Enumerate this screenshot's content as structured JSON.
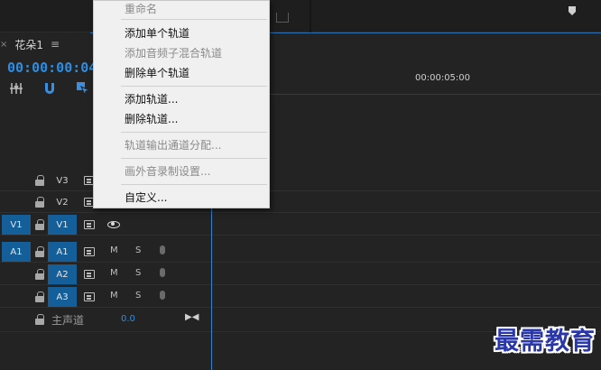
{
  "sequence": {
    "tab_label": "花朵1",
    "close_icon": "×",
    "menu_icon": "≡"
  },
  "timeline": {
    "timecode": "00:00:00:04",
    "ruler_time": "00:00:05:00"
  },
  "context_menu": {
    "items": [
      {
        "label": "重命名",
        "enabled": false
      },
      {
        "label": "添加单个轨道",
        "enabled": true
      },
      {
        "label": "添加音频子混合轨道",
        "enabled": false
      },
      {
        "label": "删除单个轨道",
        "enabled": true
      },
      {
        "label": "添加轨道...",
        "enabled": true
      },
      {
        "label": "删除轨道...",
        "enabled": true
      },
      {
        "label": "轨道输出通道分配...",
        "enabled": false
      },
      {
        "label": "画外音录制设置...",
        "enabled": false
      },
      {
        "label": "自定义...",
        "enabled": true
      }
    ]
  },
  "tracks": {
    "v3": {
      "target": "V3"
    },
    "v2": {
      "target": "V2"
    },
    "v1": {
      "source": "V1",
      "target": "V1"
    },
    "a1": {
      "source": "A1",
      "target": "A1",
      "mute": "M",
      "solo": "S"
    },
    "a2": {
      "target": "A2",
      "mute": "M",
      "solo": "S"
    },
    "a3": {
      "target": "A3",
      "mute": "M",
      "solo": "S"
    },
    "master": {
      "label": "主声道",
      "value": "0.0"
    }
  },
  "watermark": "最需教育",
  "colors": {
    "accent": "#2e8de0",
    "track_target": "#145e99",
    "watermark": "#2a37a8"
  }
}
